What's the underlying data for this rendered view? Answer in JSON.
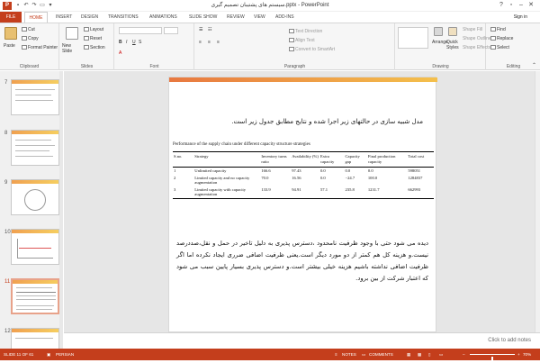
{
  "window": {
    "title": "سیستم های پشتیبان تصمیم گیری.pptx - PowerPoint",
    "sign_in": "Sign in",
    "logo": "P"
  },
  "tabs": [
    "FILE",
    "HOME",
    "INSERT",
    "DESIGN",
    "TRANSITIONS",
    "ANIMATIONS",
    "SLIDE SHOW",
    "REVIEW",
    "VIEW",
    "ADD-INS"
  ],
  "ribbon": {
    "clipboard": {
      "label": "Clipboard",
      "paste": "Paste",
      "cut": "Cut",
      "copy": "Copy",
      "format_painter": "Format Painter"
    },
    "slides": {
      "label": "Slides",
      "new_slide": "New Slide",
      "layout": "Layout",
      "reset": "Reset",
      "section": "Section"
    },
    "font": {
      "label": "Font"
    },
    "paragraph": {
      "label": "Paragraph",
      "text_direction": "Text Direction",
      "align_text": "Align Text",
      "convert_smartart": "Convert to SmartArt"
    },
    "drawing": {
      "label": "Drawing",
      "arrange": "Arrange",
      "quick_styles": "Quick Styles",
      "shape_fill": "Shape Fill",
      "shape_outline": "Shape Outline",
      "shape_effects": "Shape Effects"
    },
    "editing": {
      "label": "Editing",
      "find": "Find",
      "replace": "Replace",
      "select": "Select"
    }
  },
  "thumbnails": [
    {
      "num": "7"
    },
    {
      "num": "8"
    },
    {
      "num": "9"
    },
    {
      "num": "10"
    },
    {
      "num": "11"
    },
    {
      "num": "12"
    }
  ],
  "slide": {
    "heading": "مدل شبیه سازی در حالتهای زیر اجرا شده و نتایج مطابق جدول زیر است.",
    "table_caption": "Performance of the supply chain under different capacity structure strategies",
    "headers": [
      "S.no.",
      "Strategy",
      "Inventory turns ratio",
      "Availability (%)",
      "Extra capacity",
      "Capacity gap",
      "Final production capacity",
      "Total cost"
    ],
    "rows": [
      [
        "1",
        "Unlimited capacity",
        "166.6",
        "97.43",
        "0.0",
        "0.0",
        "0.0",
        "598051"
      ],
      [
        "2",
        "Limited capacity and no capacity augmentation",
        "70.0",
        "16.56",
        "0.0",
        "−24.7",
        "100.0",
        "1284837"
      ],
      [
        "3",
        "Limited capacity with capacity augmentation",
        "133.9",
        "94.91",
        "57.1",
        "235.8",
        "1231.7",
        "662993"
      ]
    ],
    "paragraph": "دیده می شود حتی با وجود ظرفیت نامحدود ،دسترس پذیری به دلیل تاخیر در حمل و نقل،صددرصد نیست.و هزینه کل هم کمتر از دو مورد دیگر است.یعنی ظرفیت اضافی ضرری ایجاد نکرده اما اگر ظرفیت اضافی نداشته باشیم هزینه خیلی بیشتر است.و دسترس پذیری بسیار پایین سبب می شود که اعتبار شرکت از بین برود."
  },
  "notes_placeholder": "Click to add notes",
  "status": {
    "slide_info": "SLIDE 11 OF 61",
    "language": "PERSIAN",
    "notes": "NOTES",
    "comments": "COMMENTS",
    "zoom": "70%",
    "zoom_level": 0.7
  },
  "colors": {
    "accent": "#c43e1c"
  }
}
